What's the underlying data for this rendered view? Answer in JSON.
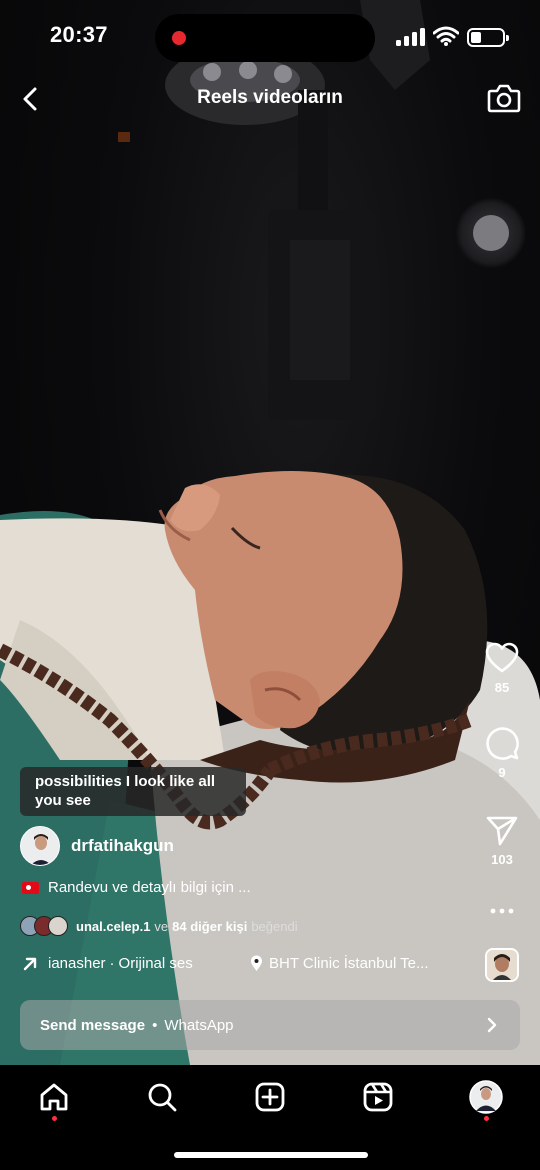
{
  "status_bar": {
    "time": "20:37",
    "recording_color": "#e5292e"
  },
  "header": {
    "title": "Reels videoların",
    "back_icon": "chevron-left-icon",
    "camera_icon": "camera-icon"
  },
  "actions": {
    "like_count": "85",
    "comment_count": "9",
    "share_count": "103"
  },
  "post": {
    "subtitle": "possibilities I look like all you see",
    "username": "drfatihakgun",
    "caption": "Randevu ve detaylı bilgi için ...",
    "liked_by_user": "unal.celep.1",
    "liked_by_connector": "ve",
    "liked_by_others": "84 diğer kişi",
    "liked_by_suffix": "beğendi",
    "audio_user": "ianasher",
    "audio_label": "Orijinal ses",
    "location": "BHT Clinic İstanbul Te..."
  },
  "message_bar": {
    "action": "Send message",
    "separator": "•",
    "channel": "WhatsApp"
  },
  "tabs": [
    "home-icon",
    "search-icon",
    "create-icon",
    "reels-icon",
    "profile-avatar"
  ],
  "colors": {
    "notification": "#ff3040",
    "message_bar_bg": "#aaaaaa"
  }
}
